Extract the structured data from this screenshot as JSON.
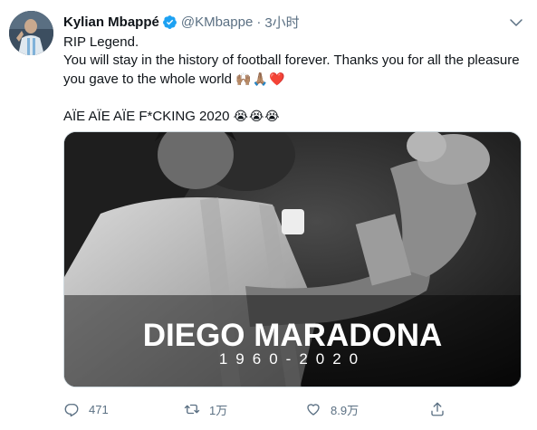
{
  "user": {
    "display_name": "Kylian Mbappé",
    "handle": "@KMbappe",
    "separator": "·",
    "time": "3小时"
  },
  "tweet": {
    "line1": "RIP Legend.",
    "line2": " You will stay in the history of football forever. Thanks you for all the pleasure",
    "line3": "you gave to the whole world",
    "line3_emoji": "🙌🏽🙏🏽❤️",
    "line4": "AÏE AÏE AÏE F*CKING 2020",
    "line4_emoji": "😭😭😭"
  },
  "media": {
    "title": "DIEGO MARADONA",
    "years": "1960-2020"
  },
  "actions": {
    "reply_count": "471",
    "retweet_count": "1万",
    "like_count": "8.9万"
  },
  "icons": {
    "verified": "verified-badge-icon",
    "caret": "chevron-down-icon",
    "reply": "reply-icon",
    "retweet": "retweet-icon",
    "like": "heart-icon",
    "share": "share-icon"
  },
  "colors": {
    "verified_blue": "#1da1f2",
    "secondary_text": "#5b7083",
    "primary_text": "#0f1419"
  }
}
